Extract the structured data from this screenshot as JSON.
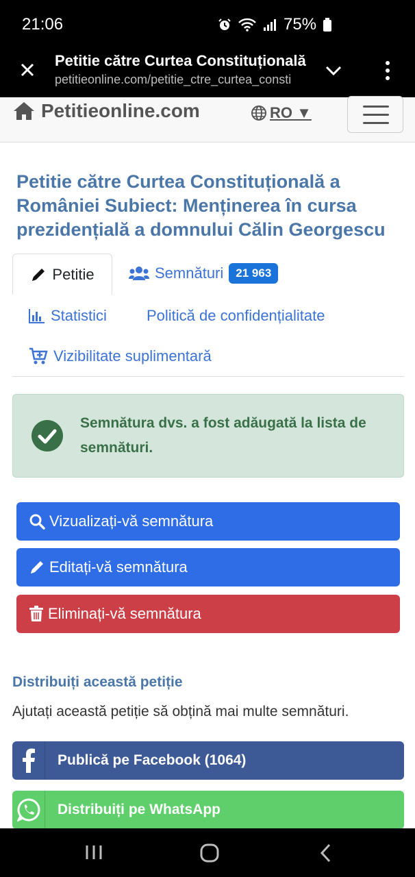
{
  "status_bar": {
    "time": "21:06",
    "battery": "75%"
  },
  "browser": {
    "title": "Petitie către Curtea Constituțională",
    "url": "petitieonline.com/petitie_ctre_curtea_consti"
  },
  "site": {
    "brand": "Petitieonline.com",
    "language": "RO ▼"
  },
  "petition": {
    "title": "Petitie către Curtea Constituțională a României Subiect: Menținerea în cursa prezidențială a domnului Călin Georgescu"
  },
  "tabs": {
    "petitie": "Petitie",
    "semnaturi": "Semnături",
    "semnaturi_count": "21 963",
    "statistici": "Statistici",
    "politica": "Politică de confidențialitate",
    "vizibilitate": "Vizibilitate suplimentară"
  },
  "alert": {
    "message": "Semnătura dvs. a fost adăugată la lista de semnături."
  },
  "actions": {
    "view": "Vizualizați-vă semnătura",
    "edit": "Editați-vă semnătura",
    "delete": "Eliminați-vă semnătura"
  },
  "share": {
    "heading": "Distribuiți această petiție",
    "text": "Ajutați această petiție să obțină mai multe semnături.",
    "facebook": "Publică pe Facebook (1064)",
    "whatsapp": "Distribuiți pe WhatsApp"
  },
  "colors": {
    "link": "#3b73d6",
    "title": "#4a76a8",
    "primary": "#2e6de6",
    "danger": "#cc3f47",
    "success_bg": "#d4e6dc",
    "facebook": "#3d5a96",
    "whatsapp": "#5fcf6c"
  }
}
